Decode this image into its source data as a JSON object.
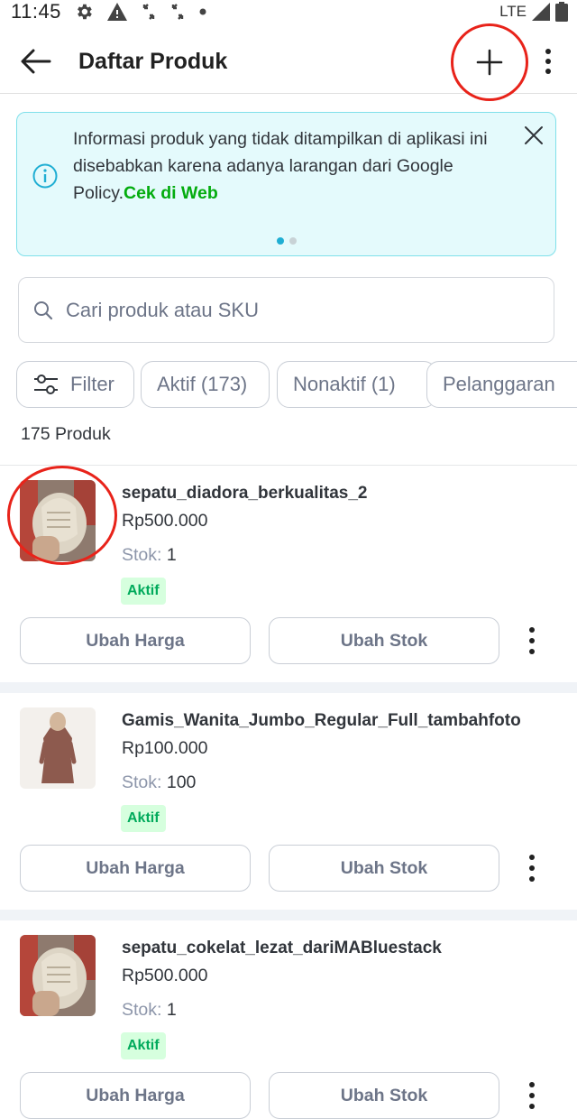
{
  "status_bar": {
    "time": "11:45",
    "network": "LTE"
  },
  "header": {
    "title": "Daftar Produk",
    "icons": [
      "arrow-left-icon",
      "plus-icon",
      "more-vertical-icon"
    ]
  },
  "banner": {
    "text": "Informasi produk yang tidak ditampilkan di aplikasi ini disebabkan karena adanya larangan dari Google Policy.",
    "link": "Cek di Web",
    "accent": "#03ac0e",
    "background": "#e4fafc",
    "border": "#7fe0ea"
  },
  "search": {
    "placeholder": "Cari produk atau SKU",
    "value": ""
  },
  "chips": {
    "filter": "Filter",
    "aktif": "Aktif (173)",
    "nonaktif": "Nonaktif (1)",
    "pelanggaran": "Pelanggaran"
  },
  "product_count": "175 Produk",
  "products": [
    {
      "name": "sepatu_diadora_berkualitas_2",
      "price": "Rp500.000",
      "stock_label": "Stok:",
      "stock": "1",
      "status": "Aktif",
      "btn_price": "Ubah Harga",
      "btn_stock": "Ubah Stok",
      "thumb": "shoe-photo"
    },
    {
      "name": "Gamis_Wanita_Jumbo_Regular_Full_tambahfoto",
      "price": "Rp100.000",
      "stock_label": "Stok:",
      "stock": "100",
      "status": "Aktif",
      "btn_price": "Ubah Harga",
      "btn_stock": "Ubah Stok",
      "thumb": "dress-photo"
    },
    {
      "name": "sepatu_cokelat_lezat_dariMABluestack",
      "price": "Rp500.000",
      "stock_label": "Stok:",
      "stock": "1",
      "status": "Aktif",
      "btn_price": "Ubah Harga",
      "btn_stock": "Ubah Stok",
      "thumb": "shoe-photo"
    }
  ],
  "colors": {
    "highlight_ring": "#e8231a",
    "badge_bg": "#d6ffde",
    "badge_text": "#00aa5b",
    "dot_active": "#1faed3"
  }
}
